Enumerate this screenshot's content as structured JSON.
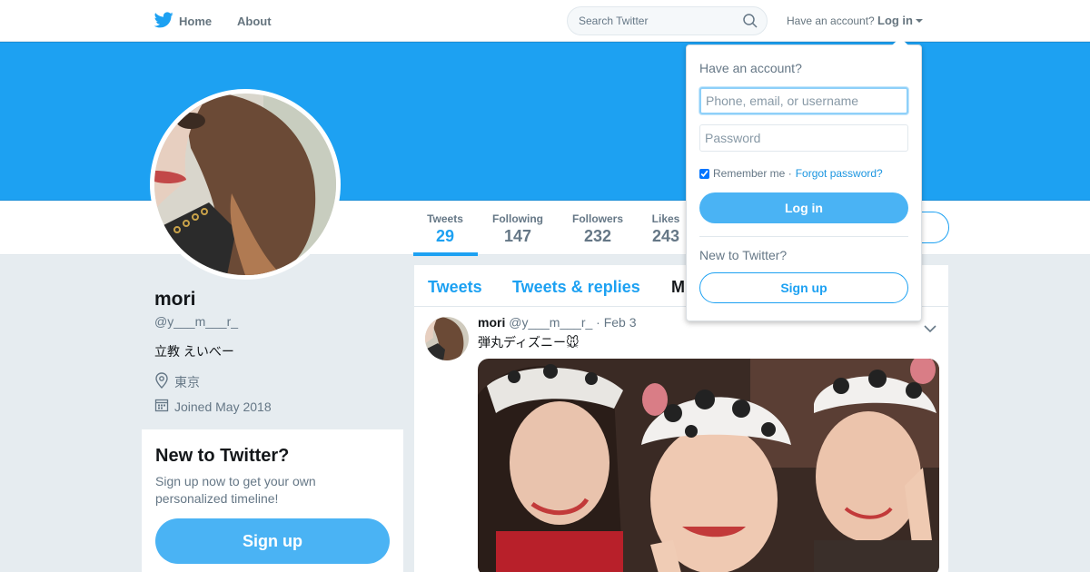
{
  "colors": {
    "accent": "#1da1f2",
    "banner": "#1da1f2",
    "button": "#4ab3f4",
    "background": "#e6ecf0"
  },
  "topnav": {
    "home_label": "Home",
    "about_label": "About",
    "search_placeholder": "Search Twitter",
    "have_account": "Have an account?",
    "login_label": "Log in",
    "logo_icon": "twitter-bird-icon"
  },
  "profile": {
    "name": "mori",
    "handle": "@y___m___r_",
    "bio": "立教 えいべー",
    "location": "東京",
    "joined": "Joined May 2018"
  },
  "stats": [
    {
      "label": "Tweets",
      "value": "29"
    },
    {
      "label": "Following",
      "value": "147"
    },
    {
      "label": "Followers",
      "value": "232"
    },
    {
      "label": "Likes",
      "value": "243"
    }
  ],
  "signup_card": {
    "title": "New to Twitter?",
    "text": "Sign up now to get your own personalized timeline!",
    "button": "Sign up"
  },
  "timeline": {
    "tabs": [
      "Tweets",
      "Tweets & replies",
      "M"
    ],
    "tweet": {
      "name": "mori",
      "handle": "@y___m___r_",
      "date": "· Feb 3",
      "text": "弾丸ディズニー🐭"
    }
  },
  "dropdown": {
    "title": "Have an account?",
    "username_placeholder": "Phone, email, or username",
    "password_placeholder": "Password",
    "remember": "Remember me ·",
    "forgot": "Forgot password?",
    "login_button": "Log in",
    "new_text": "New to Twitter?",
    "signup_button": "Sign up"
  }
}
